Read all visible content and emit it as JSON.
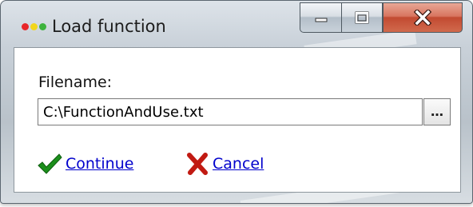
{
  "window": {
    "title": "Load function",
    "app_icon": "traffic-light-dots-icon",
    "dot_colors": [
      "#e8262a",
      "#f2d61c",
      "#3db33d"
    ],
    "caption": {
      "minimize_icon": "minimize-icon",
      "maximize_icon": "maximize-icon",
      "close_icon": "close-icon"
    }
  },
  "form": {
    "filename_label": "Filename:",
    "filename_value": "C:\\FunctionAndUse.txt",
    "browse_label": "…"
  },
  "actions": {
    "continue_label": "Continue",
    "continue_icon": "checkmark-icon",
    "cancel_label": "Cancel",
    "cancel_icon": "red-x-icon"
  },
  "colors": {
    "link": "#0000cc",
    "check": "#1b8f1b",
    "cancel_x": "#c11a12",
    "close_button": "#c9583f"
  }
}
